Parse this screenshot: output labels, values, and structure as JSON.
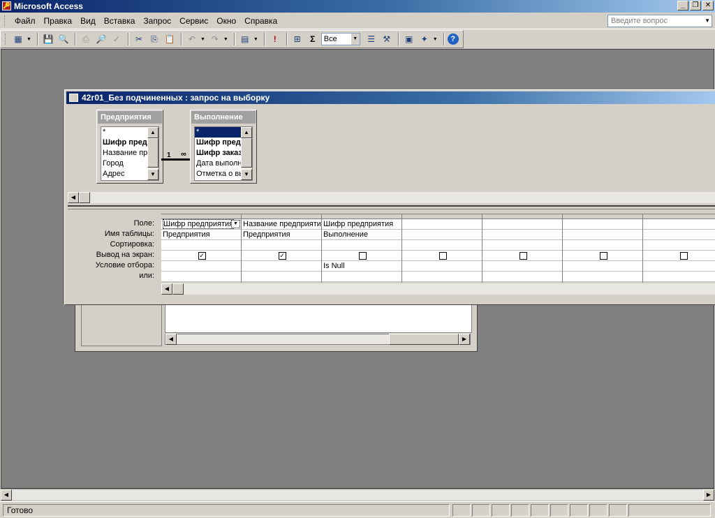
{
  "app": {
    "title": "Microsoft Access"
  },
  "window_buttons": {
    "minimize": "_",
    "restore": "❐",
    "close": "✕"
  },
  "menu": [
    "Файл",
    "Правка",
    "Вид",
    "Вставка",
    "Запрос",
    "Сервис",
    "Окно",
    "Справка"
  ],
  "ask": {
    "placeholder": "Введите вопрос"
  },
  "toolbar": {
    "icons": [
      "view-icon",
      "save-icon",
      "search-file-icon",
      "print-icon",
      "print-preview-icon",
      "spelling-icon",
      "cut-icon",
      "copy-icon",
      "paste-icon",
      "undo-icon",
      "redo-icon",
      "query-type-icon",
      "run-icon",
      "show-table-icon",
      "totals-icon",
      "properties-icon",
      "build-icon",
      "database-window-icon",
      "new-object-icon",
      "help-icon"
    ],
    "top_values": "Все"
  },
  "query_window": {
    "title": "42г01_Без подчиненных : запрос на выборку",
    "tables": [
      {
        "name": "Предприятия",
        "fields": [
          "*",
          "Шифр предприятия",
          "Название предприятия",
          "Город",
          "Адрес"
        ],
        "bold": [
          1
        ]
      },
      {
        "name": "Выполнение",
        "fields": [
          "*",
          "Шифр предприятия",
          "Шифр заказа",
          "Дата выполнения",
          "Отметка о выполнении"
        ],
        "bold": [
          1,
          2
        ],
        "selected": 0
      }
    ],
    "join": {
      "one": "1",
      "many": "∞"
    },
    "row_labels": [
      "Поле:",
      "Имя таблицы:",
      "Сортировка:",
      "Вывод на экран:",
      "Условие отбора:",
      "или:"
    ],
    "columns": [
      {
        "field": "Шифр предприятия",
        "table": "Предприятия",
        "sort": "",
        "show": true,
        "criteria": "",
        "or": ""
      },
      {
        "field": "Название предприятия",
        "table": "Предприятия",
        "sort": "",
        "show": true,
        "criteria": "",
        "or": ""
      },
      {
        "field": "Шифр предприятия",
        "table": "Выполнение",
        "sort": "",
        "show": false,
        "criteria": "Is Null",
        "or": ""
      },
      {
        "field": "",
        "table": "",
        "sort": "",
        "show": false,
        "criteria": "",
        "or": ""
      },
      {
        "field": "",
        "table": "",
        "sort": "",
        "show": false,
        "criteria": "",
        "or": ""
      },
      {
        "field": "",
        "table": "",
        "sort": "",
        "show": false,
        "criteria": "",
        "or": ""
      },
      {
        "field": "",
        "table": "",
        "sort": "",
        "show": false,
        "criteria": "",
        "or": ""
      }
    ]
  },
  "status": {
    "text": "Готово"
  },
  "colors": {
    "titlebar_start": "#0a246a",
    "titlebar_end": "#a6caf0",
    "workspace": "#808080",
    "selection": "#0a246a"
  }
}
